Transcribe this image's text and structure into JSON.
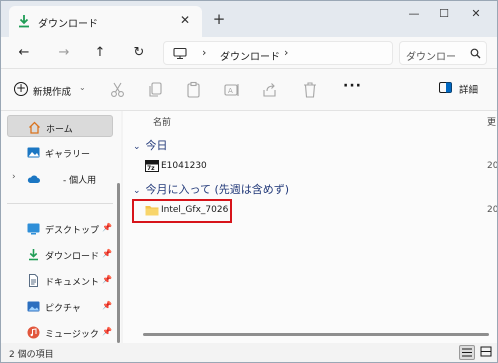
{
  "tab": {
    "title": "ダウンロード",
    "close": "✕",
    "new_tab": "+"
  },
  "window_controls": {
    "minimize": "—",
    "maximize": "☐",
    "close": "✕"
  },
  "nav": {
    "back": "←",
    "forward": "→",
    "up": "↑",
    "refresh": "↻"
  },
  "address": {
    "sep1": "›",
    "location": "ダウンロード",
    "sep2": "›"
  },
  "search": {
    "placeholder": "ダウンロー"
  },
  "toolbar": {
    "new_label": "新規作成",
    "new_caret": "⌄",
    "more": "···",
    "details_label": "詳細"
  },
  "sidebar": {
    "home": "ホーム",
    "gallery": "ギャラリー",
    "personal": "- 個人用",
    "expand": "›",
    "desktop": "デスクトップ",
    "downloads": "ダウンロード",
    "documents": "ドキュメント",
    "pictures": "ピクチャ",
    "music": "ミュージック",
    "pin": "📌"
  },
  "columns": {
    "name": "名前",
    "date": "更"
  },
  "groups": {
    "today": {
      "chevron": "⌄",
      "label": "今日"
    },
    "this_month": {
      "chevron": "⌄",
      "label": "今月に入って (先週は含めず)"
    }
  },
  "files": {
    "archive": {
      "name": "E1041230",
      "date": "20"
    },
    "folder": {
      "name": "Intel_Gfx_7026",
      "date": "20"
    }
  },
  "status": {
    "items": "2 個の項目"
  },
  "colors": {
    "accent": "#0067c0",
    "highlight_border": "#d7141a",
    "folder": "#f3c24b",
    "group_text": "#233a7a"
  }
}
